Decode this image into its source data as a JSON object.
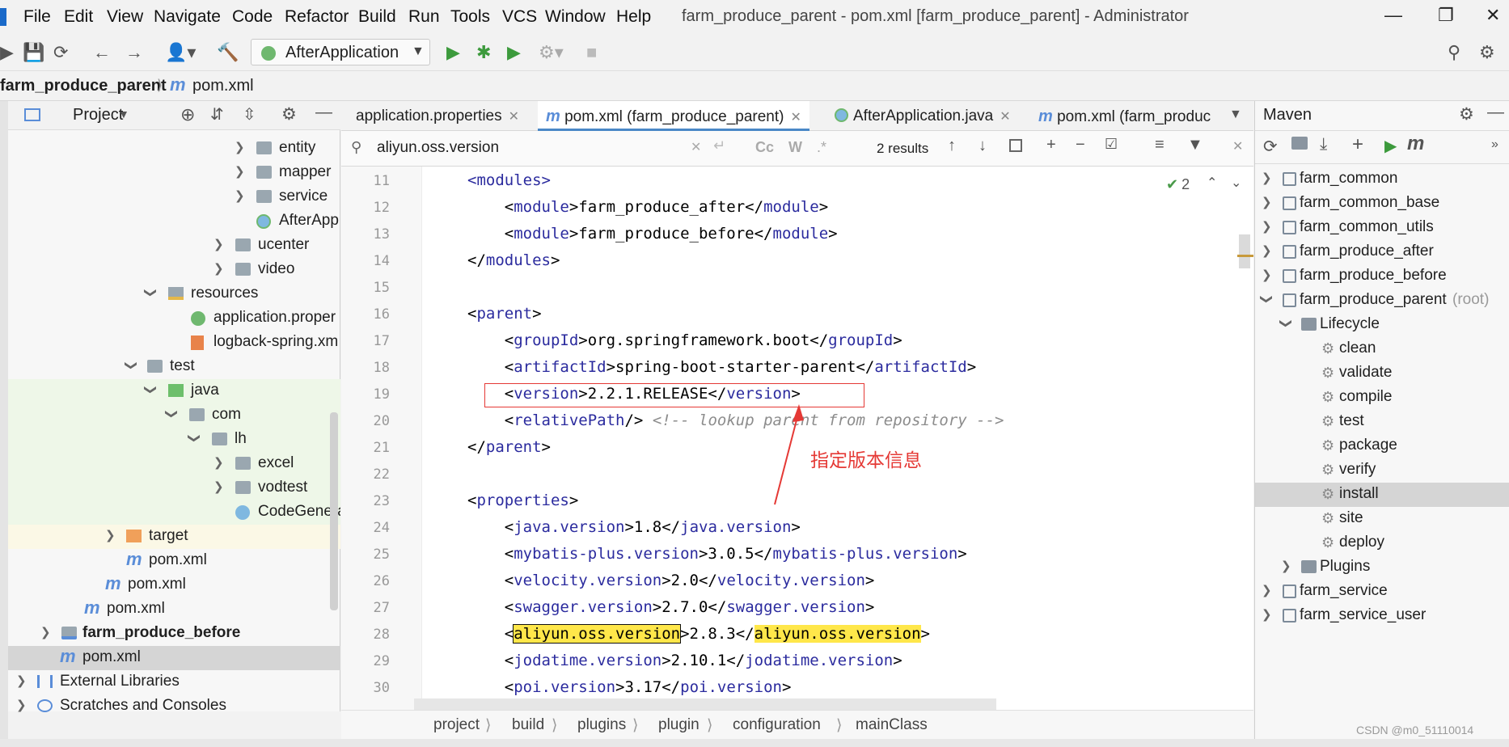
{
  "menu": [
    "File",
    "Edit",
    "View",
    "Navigate",
    "Code",
    "Refactor",
    "Build",
    "Run",
    "Tools",
    "VCS",
    "Window",
    "Help"
  ],
  "window_title": "farm_produce_parent - pom.xml [farm_produce_parent] - Administrator",
  "toolbar": {
    "run_config": "AfterApplication"
  },
  "breadcrumb": {
    "project": "farm_produce_parent",
    "file": "pom.xml"
  },
  "project_panel": {
    "title": "Project",
    "rows": [
      {
        "label": "entity"
      },
      {
        "label": "mapper"
      },
      {
        "label": "service"
      },
      {
        "label": "AfterApp"
      },
      {
        "label": "ucenter"
      },
      {
        "label": "video"
      },
      {
        "label": "resources"
      },
      {
        "label": "application.proper"
      },
      {
        "label": "logback-spring.xm"
      },
      {
        "label": "test"
      },
      {
        "label": "java"
      },
      {
        "label": "com"
      },
      {
        "label": "lh"
      },
      {
        "label": "excel"
      },
      {
        "label": "vodtest"
      },
      {
        "label": "CodeGenera"
      },
      {
        "label": "target"
      },
      {
        "label": "pom.xml"
      },
      {
        "label": "pom.xml"
      },
      {
        "label": "pom.xml"
      },
      {
        "label": "farm_produce_before"
      },
      {
        "label": "pom.xml"
      },
      {
        "label": "External Libraries"
      },
      {
        "label": "Scratches and Consoles"
      }
    ]
  },
  "tabs": [
    {
      "label": "application.properties"
    },
    {
      "label": "pom.xml (farm_produce_parent)"
    },
    {
      "label": "AfterApplication.java"
    },
    {
      "label": "pom.xml (farm_produc"
    }
  ],
  "search": {
    "query": "aliyun.oss.version",
    "options": [
      "Cc",
      "W",
      ".*"
    ],
    "results": "2 results"
  },
  "editor": {
    "inspection_count": "2",
    "lines": [
      {
        "n": "11",
        "text": "<modules>"
      },
      {
        "n": "12",
        "text": "    <module>farm_produce_after</module>"
      },
      {
        "n": "13",
        "text": "    <module>farm_produce_before</module>"
      },
      {
        "n": "14",
        "text": "</modules>"
      },
      {
        "n": "15",
        "text": ""
      },
      {
        "n": "16",
        "text": "<parent>"
      },
      {
        "n": "17",
        "text": "    <groupId>org.springframework.boot</groupId>"
      },
      {
        "n": "18",
        "text": "    <artifactId>spring-boot-starter-parent</artifactId>"
      },
      {
        "n": "19",
        "text": "    <version>2.2.1.RELEASE</version>"
      },
      {
        "n": "20",
        "text": "    <relativePath/> <!-- lookup parent from repository -->"
      },
      {
        "n": "21",
        "text": "</parent>"
      },
      {
        "n": "22",
        "text": ""
      },
      {
        "n": "23",
        "text": "<properties>"
      },
      {
        "n": "24",
        "text": "    <java.version>1.8</java.version>"
      },
      {
        "n": "25",
        "text": "    <mybatis-plus.version>3.0.5</mybatis-plus.version>"
      },
      {
        "n": "26",
        "text": "    <velocity.version>2.0</velocity.version>"
      },
      {
        "n": "27",
        "text": "    <swagger.version>2.7.0</swagger.version>"
      },
      {
        "n": "28",
        "text": "    <aliyun.oss.version>2.8.3</aliyun.oss.version>"
      },
      {
        "n": "29",
        "text": "    <jodatime.version>2.10.1</jodatime.version>"
      },
      {
        "n": "30",
        "text": "    <poi.version>3.17</poi.version>"
      }
    ],
    "annotation": "指定版本信息"
  },
  "editor_breadcrumb": [
    "project",
    "build",
    "plugins",
    "plugin",
    "configuration",
    "mainClass"
  ],
  "maven": {
    "title": "Maven",
    "rows": [
      {
        "label": "farm_common"
      },
      {
        "label": "farm_common_base"
      },
      {
        "label": "farm_common_utils"
      },
      {
        "label": "farm_produce_after"
      },
      {
        "label": "farm_produce_before"
      },
      {
        "label": "farm_produce_parent"
      },
      {
        "label": "Lifecycle"
      },
      {
        "label": "clean"
      },
      {
        "label": "validate"
      },
      {
        "label": "compile"
      },
      {
        "label": "test"
      },
      {
        "label": "package"
      },
      {
        "label": "verify"
      },
      {
        "label": "install"
      },
      {
        "label": "site"
      },
      {
        "label": "deploy"
      },
      {
        "label": "Plugins"
      },
      {
        "label": "farm_service"
      },
      {
        "label": "farm_service_user"
      }
    ],
    "root_suffix": "(root)"
  },
  "watermark": "CSDN @m0_51110014",
  "colors": {
    "accent": "#2675bf",
    "highlight": "#ffe74a",
    "annotation_red": "#e53935",
    "selection": "#d5d5d5"
  }
}
